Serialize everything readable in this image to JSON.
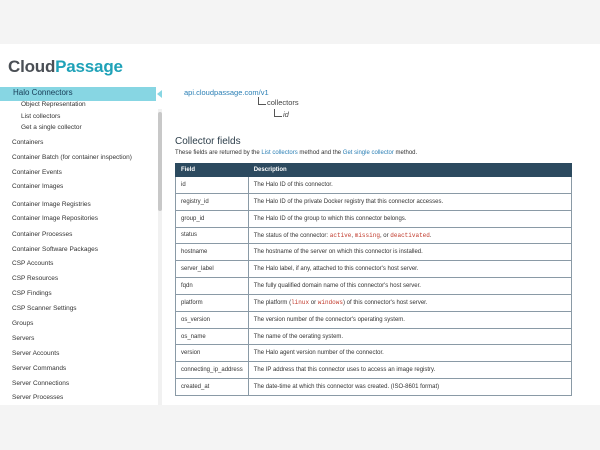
{
  "brand": {
    "part1": "Cloud",
    "part2": "Passage"
  },
  "sidebar": {
    "active": "Halo Connectors",
    "sub_items": [
      "Object Representation",
      "List collectors",
      "Get a single collector"
    ],
    "items": [
      "Containers",
      "Container Batch (for container inspection)",
      "Container Events",
      "Container Images",
      "Container Image Registries",
      "Container Image Repositories",
      "Container Processes",
      "Container Software Packages",
      "CSP Accounts",
      "CSP Resources",
      "CSP Findings",
      "CSP Scanner Settings",
      "Groups",
      "Servers",
      "Server Accounts",
      "Server Commands",
      "Server Connections",
      "Server Processes"
    ]
  },
  "main": {
    "api_url": "api.cloudpassage.com/v1",
    "tree_level1": "collectors",
    "tree_level2": "id",
    "section_title": "Collector fields",
    "intro": {
      "before": "These fields are returned by the ",
      "link1": "List collectors",
      "middle": " method and the ",
      "link2": "Get single collector",
      "after": " method."
    },
    "table": {
      "headers": [
        "Field",
        "Description"
      ],
      "rows": [
        {
          "field": "id",
          "desc": "The Halo ID of this connector."
        },
        {
          "field": "registry_id",
          "desc": "The Halo ID of the private Docker registry that this connector accesses."
        },
        {
          "field": "group_id",
          "desc": "The Halo ID of the group to which this connector belongs."
        },
        {
          "field": "status",
          "desc_pre": "The status of the connector: ",
          "code1": "active",
          "sep1": ", ",
          "code2": "missing",
          "sep2": ", or ",
          "code3": "deactivated",
          "desc_post": "."
        },
        {
          "field": "hostname",
          "desc": "The hostname of the server on which this connector is installed."
        },
        {
          "field": "server_label",
          "desc": "The Halo label, if any, attached to this connector's host server."
        },
        {
          "field": "fqdn",
          "desc": "The fully qualified domain name of this connector's host server."
        },
        {
          "field": "platform",
          "desc_pre": "The platform (",
          "code1": "linux",
          "sep1": " or ",
          "code2": "windows",
          "desc_post": ") of this connector's host server."
        },
        {
          "field": "os_version",
          "desc": "The version number of the connector's operating system."
        },
        {
          "field": "os_name",
          "desc": "The name of the oerating system."
        },
        {
          "field": "version",
          "desc": "The Halo agent version number of the connector."
        },
        {
          "field": "connecting_ip_address",
          "desc": "The IP address that this connector uses to access an image registry."
        },
        {
          "field": "created_at",
          "desc": "The date-time at which this connector was created. (ISO-8601 format)"
        }
      ]
    }
  }
}
